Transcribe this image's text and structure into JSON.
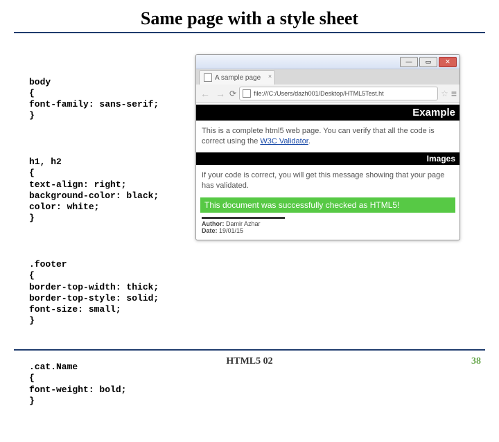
{
  "title": "Same page with a style sheet",
  "code": {
    "block1": "body\n{\nfont-family: sans-serif;\n}",
    "block2": "h1, h2\n{\ntext-align: right;\nbackground-color: black;\ncolor: white;\n}",
    "block3": ".footer\n{\nborder-top-width: thick;\nborder-top-style: solid;\nfont-size: small;\n}",
    "block4": ".cat.Name\n{\nfont-weight: bold;\n}"
  },
  "browser": {
    "tab_title": "A sample page",
    "url": "file:///C:/Users/dazh001/Desktop/HTML5Test.ht",
    "heading1": "Example",
    "para1_a": "This is a complete html5 web page. You can verify that all the code is correct using the ",
    "para1_link": "W3C Validator",
    "para1_b": ".",
    "heading2": "Images",
    "para2": "If your code is correct, you will get this message showing that your page has validated.",
    "validator": "This document was successfully checked as HTML5!",
    "footer_author_label": "Author:",
    "footer_author": "Damir Azhar",
    "footer_date_label": "Date:",
    "footer_date": "19/01/15"
  },
  "slide_footer": "HTML5 02",
  "slide_number": "38"
}
